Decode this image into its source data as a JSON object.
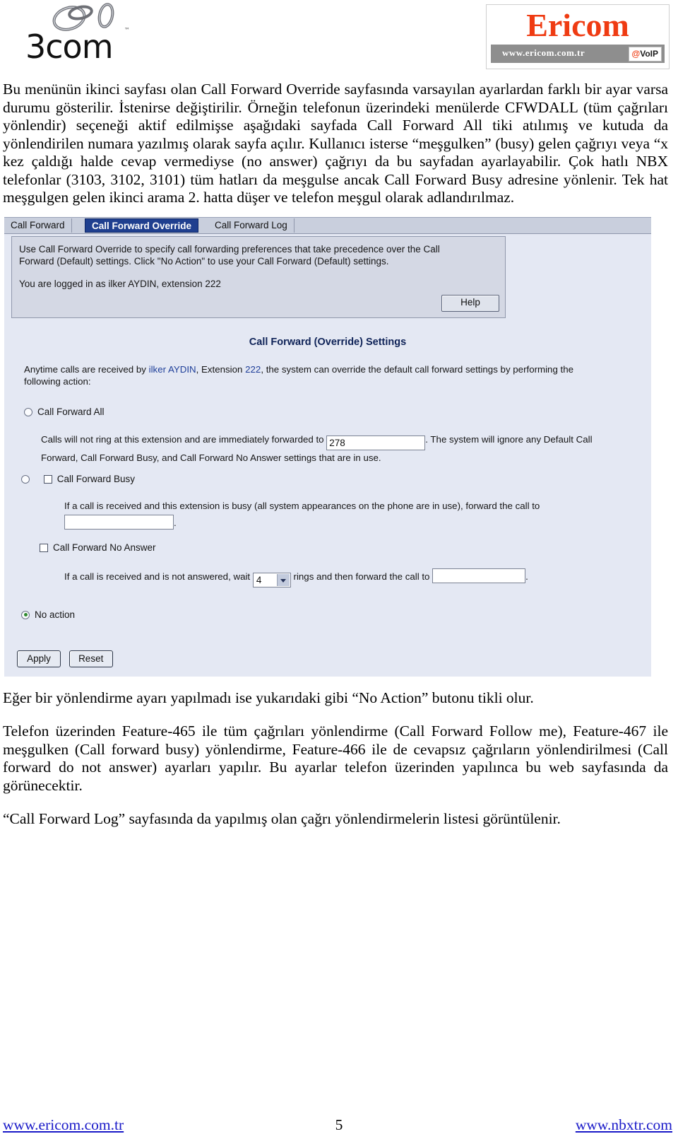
{
  "header": {
    "threecom_logo_text": "3com",
    "threecom_tm": "™",
    "ericom_brand": "Ericom",
    "ericom_site": "www.ericom.com.tr",
    "voip_badge_at": "@",
    "voip_badge_text": "VoIP"
  },
  "intro": {
    "paragraph": "Bu menünün ikinci sayfası olan Call Forward Override sayfasında varsayılan ayarlardan farklı bir ayar varsa durumu gösterilir. İstenirse değiştirilir. Örneğin telefonun üzerindeki menülerde CFWDALL (tüm çağrıları yönlendir) seçeneği aktif edilmişse aşağıdaki sayfada Call Forward All tiki atılımış ve kutuda da yönlendirilen numara yazılmış olarak sayfa açılır. Kullanıcı isterse “meşgulken” (busy) gelen çağrıyı veya “x kez çaldığı halde cevap vermediyse (no answer) çağrıyı da bu sayfadan ayarlayabilir. Çok hatlı NBX telefonlar (3103, 3102, 3101) tüm hatları da meşgulse ancak Call Forward Busy adresine yönlenir. Tek hat meşgulgen gelen ikinci arama 2. hatta düşer ve telefon meşgul olarak adlandırılmaz."
  },
  "screenshot": {
    "tabs": [
      {
        "label": "Call Forward",
        "active": false
      },
      {
        "label": "Call Forward Override",
        "active": true
      },
      {
        "label": "Call Forward Log",
        "active": false
      }
    ],
    "info": {
      "line1": "Use Call Forward Override to specify call forwarding preferences that take precedence over the Call",
      "line2": "Forward (Default) settings. Click \"No Action\" to use your Call Forward (Default) settings.",
      "line3": "You are logged in as ilker AYDIN, extension 222",
      "help_label": "Help"
    },
    "settings_title": "Call Forward (Override) Settings",
    "description": {
      "pre": "Anytime calls are received by ",
      "user": "ilker AYDIN",
      "mid": ", Extension ",
      "extension": "222",
      "post": ", the system can override the default call forward settings by performing the",
      "line2": "following action:"
    },
    "call_forward_all": {
      "radio_label": "Call Forward All",
      "radio_checked": false,
      "text_before": "Calls will not ring at this extension and are immediately forwarded to",
      "value": "278",
      "text_after": ". The system will ignore any Default Call",
      "line2": "Forward, Call Forward Busy, and Call Forward No Answer settings that are in use."
    },
    "call_forward_busy": {
      "radio_checked": false,
      "checkbox_checked": false,
      "label": "Call Forward Busy",
      "text": "If a call is received and this extension is busy (all system appearances on the phone are in use), forward the call to",
      "value": "",
      "period": "."
    },
    "call_forward_no_answer": {
      "checkbox_checked": false,
      "label": "Call Forward No Answer",
      "text_before": "If a call is received and is not answered, wait",
      "rings_value": "4",
      "text_middle": "rings and then forward the call to",
      "value": "",
      "period": "."
    },
    "no_action": {
      "radio_label": "No action",
      "radio_checked": true
    },
    "buttons": {
      "apply": "Apply",
      "reset": "Reset"
    }
  },
  "after_shot": {
    "paragraph1": "Eğer bir yönlendirme ayarı yapılmadı ise yukarıdaki gibi “No Action” butonu tikli olur.",
    "paragraph2": "Telefon üzerinden Feature-465 ile tüm çağrıları yönlendirme (Call Forward Follow me), Feature-467 ile meşgulken (Call forward busy)  yönlendirme, Feature-466 ile de cevapsız çağrıların yönlendirilmesi (Call forward do not answer) ayarları yapılır. Bu ayarlar telefon üzerinden yapılınca bu web sayfasında da görünecektir.",
    "paragraph3": "“Call Forward Log” sayfasında da yapılmış olan çağrı yönlendirmelerin listesi görüntülenir."
  },
  "footer": {
    "left_link": "www.ericom.com.tr",
    "page_number": "5",
    "right_link": "www.nbxtr.com"
  }
}
